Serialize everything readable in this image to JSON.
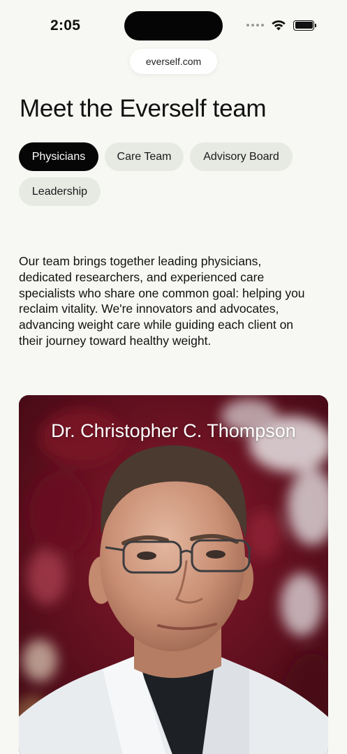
{
  "status_bar": {
    "time": "2:05",
    "icons": [
      "signal-dots-icon",
      "wifi-icon",
      "battery-icon"
    ]
  },
  "browser": {
    "url": "everself.com"
  },
  "page": {
    "title": "Meet the Everself team",
    "tabs": [
      {
        "label": "Physicians",
        "active": true
      },
      {
        "label": "Care Team",
        "active": false
      },
      {
        "label": "Advisory Board",
        "active": false
      },
      {
        "label": "Leadership",
        "active": false
      }
    ],
    "intro_lines": [
      "Our team brings together leading physicians,",
      "dedicated researchers, and experienced care",
      "specialists who share one common goal: helping you",
      "reclaim vitality. We're innovators and advocates,",
      "advancing weight care while guiding each client on",
      "their journey toward healthy weight."
    ]
  },
  "profile_card": {
    "name": "Dr. Christopher C. Thompson",
    "photo_icon": "physician-portrait-photo"
  },
  "colors": {
    "background": "#f7f8f3",
    "tab_active_bg": "#060606",
    "tab_inactive_bg": "#e7e9e3",
    "card_foliage": "#7a1426"
  }
}
